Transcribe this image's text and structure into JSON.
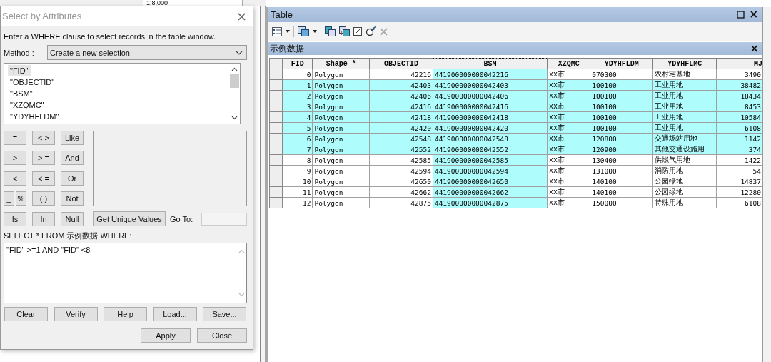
{
  "map_toolbar": {
    "scale": "1:8,000"
  },
  "dialog": {
    "title": "Select by Attributes",
    "close": "×",
    "instruction": "Enter a WHERE clause to select records in the table window.",
    "method_label": "Method :",
    "method_value": "Create a new selection",
    "fields": [
      {
        "label": "\"FID\"",
        "selected": true
      },
      {
        "label": "\"OBJECTID\"",
        "selected": false
      },
      {
        "label": "\"BSM\"",
        "selected": false
      },
      {
        "label": "\"XZQMC\"",
        "selected": false
      },
      {
        "label": "\"YDYHFLDM\"",
        "selected": false
      }
    ],
    "operators": [
      {
        "label": "=",
        "kind": "full"
      },
      {
        "label": "< >",
        "kind": "full"
      },
      {
        "label": "Like",
        "kind": "full"
      },
      {
        "label": ">",
        "kind": "full"
      },
      {
        "label": "> =",
        "kind": "full"
      },
      {
        "label": "And",
        "kind": "full"
      },
      {
        "label": "<",
        "kind": "full"
      },
      {
        "label": "< =",
        "kind": "full"
      },
      {
        "label": "Or",
        "kind": "full"
      },
      {
        "label": "_",
        "kind": "half"
      },
      {
        "label": "%",
        "kind": "half"
      },
      {
        "label": "( )",
        "kind": "full"
      },
      {
        "label": "Not",
        "kind": "full"
      },
      {
        "label": "Is",
        "kind": "full"
      },
      {
        "label": "In",
        "kind": "full"
      },
      {
        "label": "Null",
        "kind": "full"
      }
    ],
    "unique_values_button": "Get Unique Values",
    "goto_label": "Go To:",
    "sql_prefix": "SELECT * FROM 示例数据 WHERE:",
    "sql_expression": "\"FID\" >=1 AND \"FID\" <8",
    "buttons": [
      "Clear",
      "Verify",
      "Help",
      "Load...",
      "Save..."
    ],
    "footer_buttons": [
      "Apply",
      "Close"
    ]
  },
  "table_window": {
    "title": "Table",
    "close": "×",
    "tab_title": "示例数据",
    "tab_close": "×",
    "columns": [
      {
        "label": "FID",
        "selected": false
      },
      {
        "label": "Shape *",
        "selected": false
      },
      {
        "label": "OBJECTID",
        "selected": false
      },
      {
        "label": "BSM",
        "selected": true
      },
      {
        "label": "XZQMC",
        "selected": false
      },
      {
        "label": "YDYHFLDM",
        "selected": false
      },
      {
        "label": "YDYHFLMC",
        "selected": false
      },
      {
        "label": "MJ",
        "selected": false
      }
    ],
    "rows": [
      {
        "selected": false,
        "cells": [
          "0",
          "Polygon",
          "42216",
          "441900000000042216",
          "xx市",
          "070300",
          "农村宅基地",
          "3490"
        ]
      },
      {
        "selected": true,
        "cells": [
          "1",
          "Polygon",
          "42403",
          "441900000000042403",
          "xx市",
          "100100",
          "工业用地",
          "38482"
        ]
      },
      {
        "selected": true,
        "cells": [
          "2",
          "Polygon",
          "42406",
          "441900000000042406",
          "xx市",
          "100100",
          "工业用地",
          "18434"
        ]
      },
      {
        "selected": true,
        "cells": [
          "3",
          "Polygon",
          "42416",
          "441900000000042416",
          "xx市",
          "100100",
          "工业用地",
          "8453"
        ]
      },
      {
        "selected": true,
        "cells": [
          "4",
          "Polygon",
          "42418",
          "441900000000042418",
          "xx市",
          "100100",
          "工业用地",
          "10584"
        ]
      },
      {
        "selected": true,
        "cells": [
          "5",
          "Polygon",
          "42420",
          "441900000000042420",
          "xx市",
          "100100",
          "工业用地",
          "6108"
        ]
      },
      {
        "selected": true,
        "cells": [
          "6",
          "Polygon",
          "42548",
          "441900000000042548",
          "xx市",
          "120800",
          "交通场站用地",
          "1142"
        ]
      },
      {
        "selected": true,
        "cells": [
          "7",
          "Polygon",
          "42552",
          "441900000000042552",
          "xx市",
          "120900",
          "其他交通设施用",
          "374"
        ]
      },
      {
        "selected": false,
        "cells": [
          "8",
          "Polygon",
          "42585",
          "441900000000042585",
          "xx市",
          "130400",
          "供燃气用地",
          "1422"
        ]
      },
      {
        "selected": false,
        "cells": [
          "9",
          "Polygon",
          "42594",
          "441900000000042594",
          "xx市",
          "131000",
          "消防用地",
          "54"
        ]
      },
      {
        "selected": false,
        "cells": [
          "10",
          "Polygon",
          "42650",
          "441900000000042650",
          "xx市",
          "140100",
          "公园绿地",
          "14837"
        ]
      },
      {
        "selected": false,
        "cells": [
          "11",
          "Polygon",
          "42662",
          "441900000000042662",
          "xx市",
          "140100",
          "公园绿地",
          "12280"
        ]
      },
      {
        "selected": false,
        "cells": [
          "12",
          "Polygon",
          "42875",
          "441900000000042875",
          "xx市",
          "150000",
          "特殊用地",
          "6108"
        ]
      }
    ]
  }
}
